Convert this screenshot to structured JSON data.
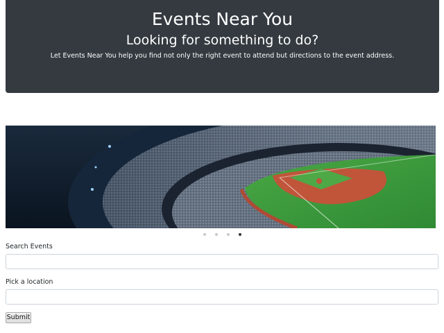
{
  "header": {
    "title": "Events Near You",
    "subtitle": "Looking for something to do?",
    "description": "Let Events Near You help you find not only the right event to attend but directions to the event address."
  },
  "carousel": {
    "image_subject": "baseball stadium aerial view",
    "slide_count": 4,
    "active_index": 3
  },
  "form": {
    "search_label": "Search Events",
    "search_value": "",
    "location_label": "Pick a location",
    "location_value": "",
    "submit_label": "Submit"
  },
  "colors": {
    "header_bg": "#343a40",
    "header_text": "#ffffff",
    "field_green": "#3e9a3a",
    "infield_dirt": "#c0553a"
  }
}
